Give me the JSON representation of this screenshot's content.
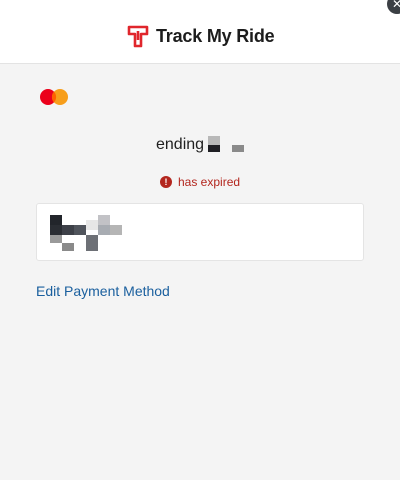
{
  "header": {
    "brand": "Track My Ride",
    "logo_icon": "track-my-ride-logo-icon",
    "brand_color": "#e0262c",
    "close_icon": "close-icon"
  },
  "payment": {
    "card_brand_icon": "mastercard-icon",
    "ending_label": "ending",
    "status_text": "has expired",
    "status_icon": "alert-circle-icon",
    "status_color": "#b3261e"
  },
  "actions": {
    "edit_label": "Edit Payment Method",
    "link_color": "#1a5f9e"
  }
}
